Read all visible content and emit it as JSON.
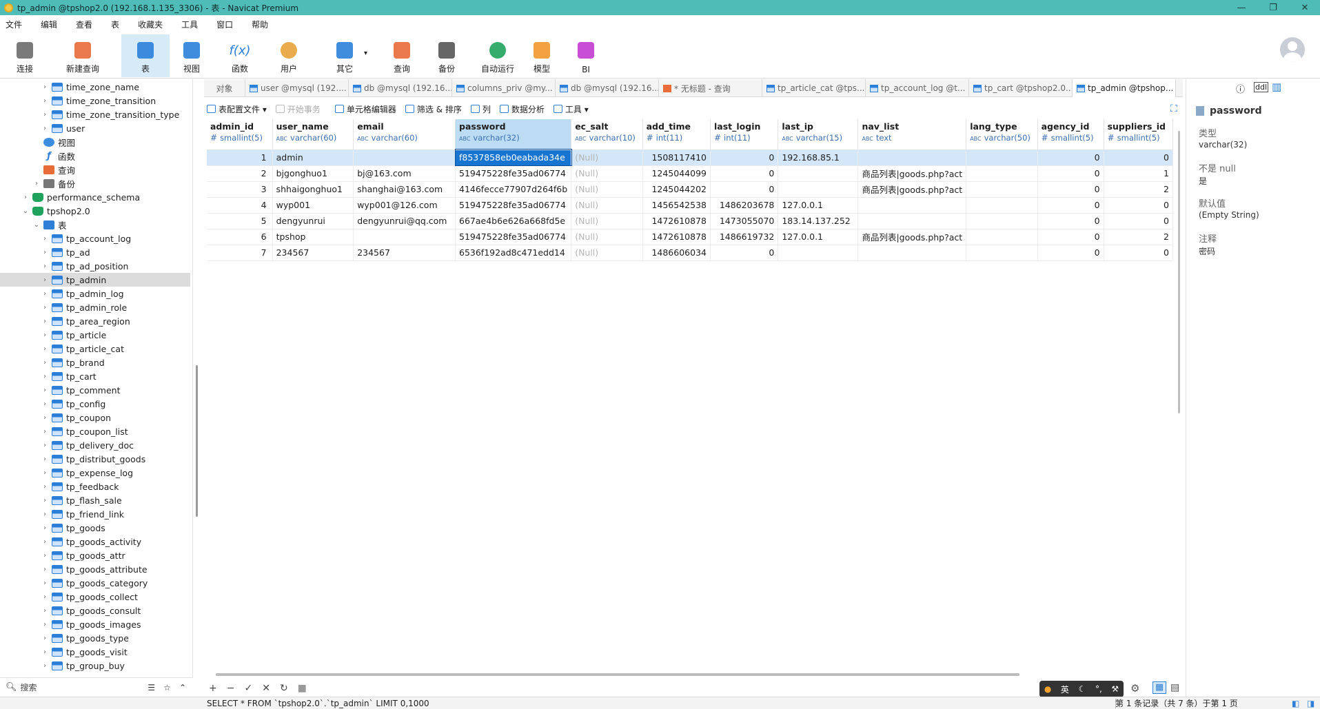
{
  "window": {
    "title": "tp_admin @tpshop2.0 (192.168.1.135_3306) - 表 - Navicat Premium"
  },
  "menu": [
    "文件",
    "编辑",
    "查看",
    "表",
    "收藏夹",
    "工具",
    "窗口",
    "帮助"
  ],
  "toolbar": [
    {
      "label": "连接",
      "icon": "plug-icon"
    },
    {
      "label": "新建查询",
      "icon": "new-query-icon"
    },
    {
      "label": "表",
      "icon": "table-icon"
    },
    {
      "label": "视图",
      "icon": "view-icon"
    },
    {
      "label": "函数",
      "icon": "function-icon",
      "glyph": "f(x)"
    },
    {
      "label": "用户",
      "icon": "user-icon"
    },
    {
      "label": "其它",
      "icon": "tools-icon"
    },
    {
      "label": "查询",
      "icon": "query-icon"
    },
    {
      "label": "备份",
      "icon": "backup-icon"
    },
    {
      "label": "自动运行",
      "icon": "robot-icon"
    },
    {
      "label": "模型",
      "icon": "model-icon"
    },
    {
      "label": "BI",
      "icon": "bi-icon"
    }
  ],
  "tree": [
    {
      "label": "time_zone_name",
      "type": "tbl",
      "indent": 3
    },
    {
      "label": "time_zone_transition",
      "type": "tbl",
      "indent": 3
    },
    {
      "label": "time_zone_transition_type",
      "type": "tbl",
      "indent": 3
    },
    {
      "label": "user",
      "type": "tbl",
      "indent": 3
    },
    {
      "label": "视图",
      "type": "view",
      "indent": 2
    },
    {
      "label": "函数",
      "type": "func",
      "indent": 2
    },
    {
      "label": "查询",
      "type": "query",
      "indent": 2
    },
    {
      "label": "备份",
      "type": "backup",
      "indent": 2
    },
    {
      "label": "performance_schema",
      "type": "db",
      "indent": 1
    },
    {
      "label": "tpshop2.0",
      "type": "db",
      "indent": 1,
      "open": true
    },
    {
      "label": "表",
      "type": "folder",
      "indent": 2,
      "open": true
    },
    {
      "label": "tp_account_log",
      "type": "tbl",
      "indent": 3
    },
    {
      "label": "tp_ad",
      "type": "tbl",
      "indent": 3
    },
    {
      "label": "tp_ad_position",
      "type": "tbl",
      "indent": 3
    },
    {
      "label": "tp_admin",
      "type": "tbl",
      "indent": 3,
      "selected": true
    },
    {
      "label": "tp_admin_log",
      "type": "tbl",
      "indent": 3
    },
    {
      "label": "tp_admin_role",
      "type": "tbl",
      "indent": 3
    },
    {
      "label": "tp_area_region",
      "type": "tbl",
      "indent": 3
    },
    {
      "label": "tp_article",
      "type": "tbl",
      "indent": 3
    },
    {
      "label": "tp_article_cat",
      "type": "tbl",
      "indent": 3
    },
    {
      "label": "tp_brand",
      "type": "tbl",
      "indent": 3
    },
    {
      "label": "tp_cart",
      "type": "tbl",
      "indent": 3
    },
    {
      "label": "tp_comment",
      "type": "tbl",
      "indent": 3
    },
    {
      "label": "tp_config",
      "type": "tbl",
      "indent": 3
    },
    {
      "label": "tp_coupon",
      "type": "tbl",
      "indent": 3
    },
    {
      "label": "tp_coupon_list",
      "type": "tbl",
      "indent": 3
    },
    {
      "label": "tp_delivery_doc",
      "type": "tbl",
      "indent": 3
    },
    {
      "label": "tp_distribut_goods",
      "type": "tbl",
      "indent": 3
    },
    {
      "label": "tp_expense_log",
      "type": "tbl",
      "indent": 3
    },
    {
      "label": "tp_feedback",
      "type": "tbl",
      "indent": 3
    },
    {
      "label": "tp_flash_sale",
      "type": "tbl",
      "indent": 3
    },
    {
      "label": "tp_friend_link",
      "type": "tbl",
      "indent": 3
    },
    {
      "label": "tp_goods",
      "type": "tbl",
      "indent": 3
    },
    {
      "label": "tp_goods_activity",
      "type": "tbl",
      "indent": 3
    },
    {
      "label": "tp_goods_attr",
      "type": "tbl",
      "indent": 3
    },
    {
      "label": "tp_goods_attribute",
      "type": "tbl",
      "indent": 3
    },
    {
      "label": "tp_goods_category",
      "type": "tbl",
      "indent": 3
    },
    {
      "label": "tp_goods_collect",
      "type": "tbl",
      "indent": 3
    },
    {
      "label": "tp_goods_consult",
      "type": "tbl",
      "indent": 3
    },
    {
      "label": "tp_goods_images",
      "type": "tbl",
      "indent": 3
    },
    {
      "label": "tp_goods_type",
      "type": "tbl",
      "indent": 3
    },
    {
      "label": "tp_goods_visit",
      "type": "tbl",
      "indent": 3
    },
    {
      "label": "tp_group_buy",
      "type": "tbl",
      "indent": 3
    }
  ],
  "search": {
    "placeholder": "搜索"
  },
  "tabs": [
    {
      "label": "对象",
      "type": "none"
    },
    {
      "label": "user @mysql (192....",
      "type": "tbl"
    },
    {
      "label": "db @mysql (192.16...",
      "type": "tbl"
    },
    {
      "label": "columns_priv @my...",
      "type": "tbl"
    },
    {
      "label": "db @mysql (192.16...",
      "type": "tbl"
    },
    {
      "label": "* 无标题 - 查询",
      "type": "q"
    },
    {
      "label": "tp_article_cat @tps...",
      "type": "tbl"
    },
    {
      "label": "tp_account_log @t...",
      "type": "tbl"
    },
    {
      "label": "tp_cart @tpshop2.0...",
      "type": "tbl"
    },
    {
      "label": "tp_admin @tpshop...",
      "type": "tbl",
      "active": true
    }
  ],
  "subtoolbar": [
    {
      "label": "表配置文件 ▾",
      "disabled": false
    },
    {
      "label": "开始事务",
      "disabled": true
    },
    {
      "label": "单元格编辑器",
      "disabled": false
    },
    {
      "label": "筛选 & 排序",
      "disabled": false
    },
    {
      "label": "列",
      "disabled": false
    },
    {
      "label": "数据分析",
      "disabled": false
    },
    {
      "label": "工具 ▾",
      "disabled": false
    }
  ],
  "columns": [
    {
      "name": "admin_id",
      "type": "smallint(5)",
      "kind": "#"
    },
    {
      "name": "user_name",
      "type": "varchar(60)",
      "kind": "ABC"
    },
    {
      "name": "email",
      "type": "varchar(60)",
      "kind": "ABC"
    },
    {
      "name": "password",
      "type": "varchar(32)",
      "kind": "ABC",
      "selected": true
    },
    {
      "name": "ec_salt",
      "type": "varchar(10)",
      "kind": "ABC"
    },
    {
      "name": "add_time",
      "type": "int(11)",
      "kind": "#"
    },
    {
      "name": "last_login",
      "type": "int(11)",
      "kind": "#"
    },
    {
      "name": "last_ip",
      "type": "varchar(15)",
      "kind": "ABC"
    },
    {
      "name": "nav_list",
      "type": "text",
      "kind": "ABC"
    },
    {
      "name": "lang_type",
      "type": "varchar(50)",
      "kind": "ABC"
    },
    {
      "name": "agency_id",
      "type": "smallint(5)",
      "kind": "#"
    },
    {
      "name": "suppliers_id",
      "type": "smallint(5)",
      "kind": "#"
    }
  ],
  "rows": [
    [
      "1",
      "admin",
      "",
      "f8537858eb0eabada34e",
      "(Null)",
      "1508117410",
      "0",
      "192.168.85.1",
      "",
      "",
      "0",
      "0"
    ],
    [
      "2",
      "bjgonghuo1",
      "bj@163.com",
      "519475228fe35ad06774",
      "(Null)",
      "1245044099",
      "0",
      "",
      "商品列表|goods.php?act",
      "",
      "0",
      "1"
    ],
    [
      "3",
      "shhaigonghuo1",
      "shanghai@163.com",
      "4146fecce77907d264f6b",
      "(Null)",
      "1245044202",
      "0",
      "",
      "商品列表|goods.php?act",
      "",
      "0",
      "2"
    ],
    [
      "4",
      "wyp001",
      "wyp001@126.com",
      "519475228fe35ad06774",
      "(Null)",
      "1456542538",
      "1486203678",
      "127.0.0.1",
      "",
      "",
      "0",
      "0"
    ],
    [
      "5",
      "dengyunrui",
      "dengyunrui@qq.com",
      "667ae4b6e626a668fd5e",
      "(Null)",
      "1472610878",
      "1473055070",
      "183.14.137.252",
      "",
      "",
      "0",
      "0"
    ],
    [
      "6",
      "tpshop",
      "",
      "519475228fe35ad06774",
      "(Null)",
      "1472610878",
      "1486619732",
      "127.0.0.1",
      "商品列表|goods.php?act",
      "",
      "0",
      "2"
    ],
    [
      "7",
      "234567",
      "234567",
      "6536f192ad8c471edd14",
      "(Null)",
      "1486606034",
      "0",
      "",
      "",
      "",
      "0",
      "0"
    ]
  ],
  "ime": {
    "label": "英"
  },
  "status": {
    "sql": "SELECT * FROM `tpshop2.0`.`tp_admin` LIMIT 0,1000",
    "records": "第 1 条记录（共 7 条）于第 1 页"
  },
  "rightpanel": {
    "field": "password",
    "type_label": "类型",
    "type_value": "varchar(32)",
    "notnull_label": "不是 null",
    "notnull_value": "是",
    "default_label": "默认值",
    "default_value": "(Empty String)",
    "comment_label": "注释",
    "comment_value": "密码"
  }
}
